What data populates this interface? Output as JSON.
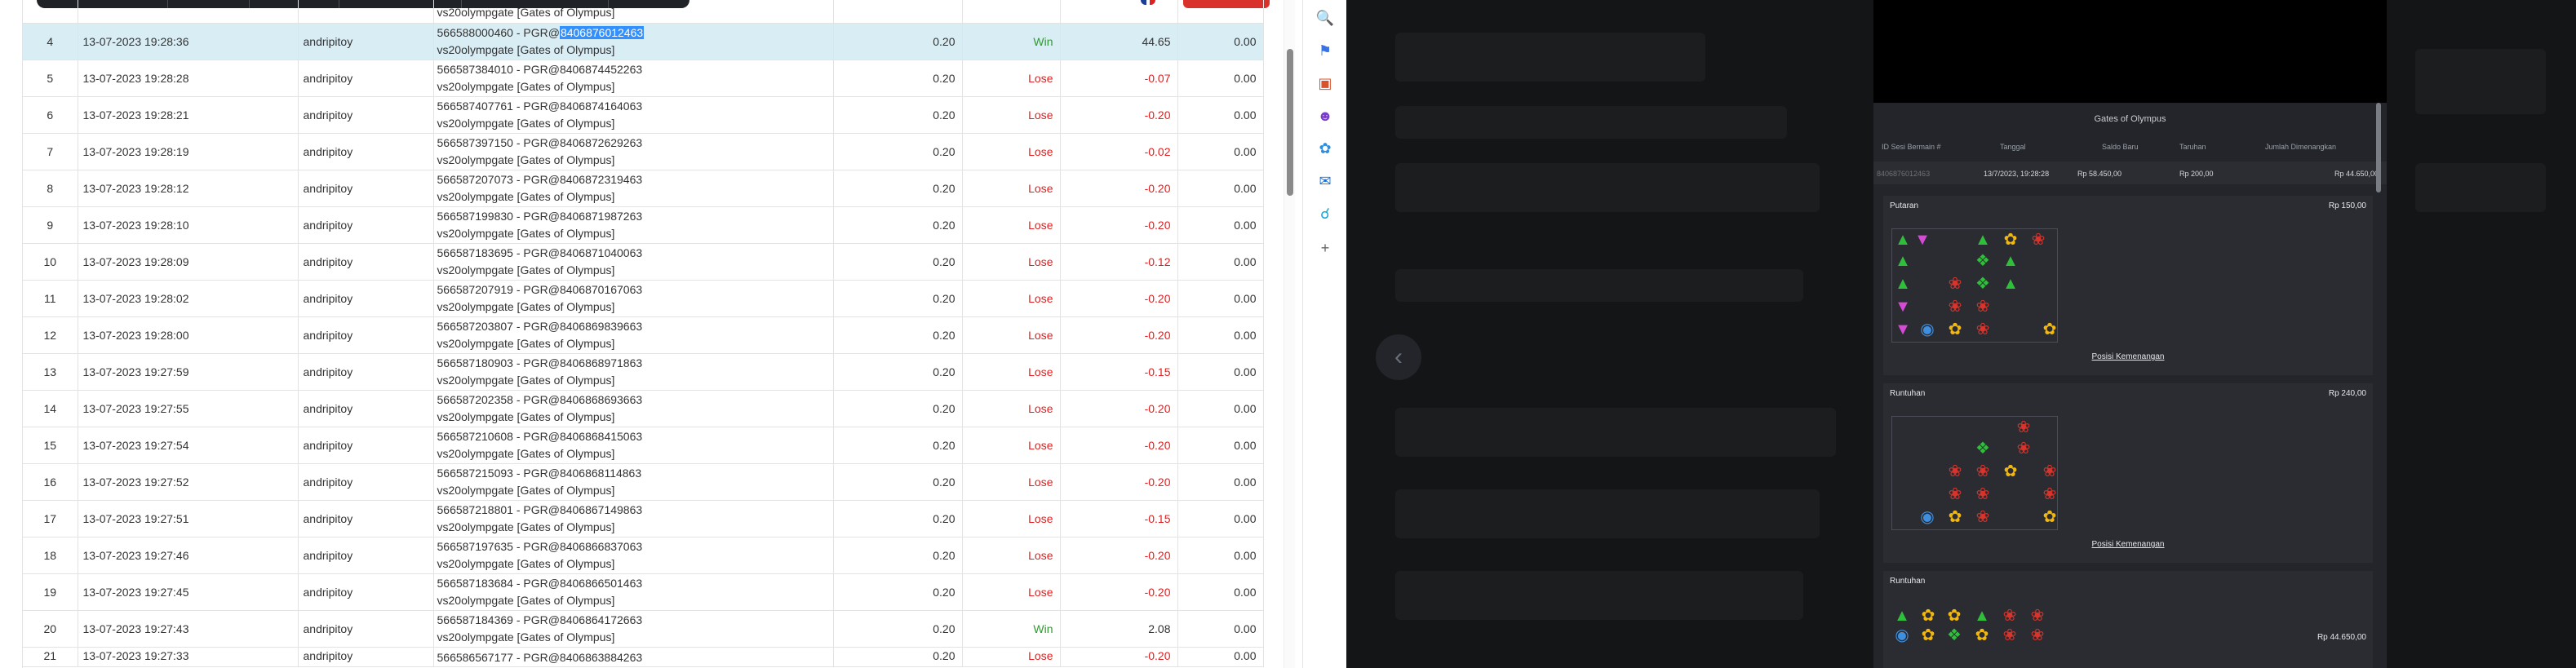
{
  "rows_partial_top": {
    "desc2": "vs20olympgate [Gates of Olympus]"
  },
  "rows": [
    {
      "no": "4",
      "datetime": "13-07-2023 19:28:36",
      "user": "andripitoy",
      "ref_prefix": "566588000460 - PGR@",
      "ref_id": "8406876012463",
      "game": "vs20olympgate [Gates of Olympus]",
      "amount": "0.20",
      "result": "Win",
      "pl": "44.65",
      "bal": "0.00",
      "selected": true
    },
    {
      "no": "5",
      "datetime": "13-07-2023 19:28:28",
      "user": "andripitoy",
      "ref_prefix": "566587384010 - PGR@",
      "ref_id": "8406874452263",
      "game": "vs20olympgate [Gates of Olympus]",
      "amount": "0.20",
      "result": "Lose",
      "pl": "-0.07",
      "bal": "0.00"
    },
    {
      "no": "6",
      "datetime": "13-07-2023 19:28:21",
      "user": "andripitoy",
      "ref_prefix": "566587407761 - PGR@",
      "ref_id": "8406874164063",
      "game": "vs20olympgate [Gates of Olympus]",
      "amount": "0.20",
      "result": "Lose",
      "pl": "-0.20",
      "bal": "0.00"
    },
    {
      "no": "7",
      "datetime": "13-07-2023 19:28:19",
      "user": "andripitoy",
      "ref_prefix": "566587397150 - PGR@",
      "ref_id": "8406872629263",
      "game": "vs20olympgate [Gates of Olympus]",
      "amount": "0.20",
      "result": "Lose",
      "pl": "-0.02",
      "bal": "0.00"
    },
    {
      "no": "8",
      "datetime": "13-07-2023 19:28:12",
      "user": "andripitoy",
      "ref_prefix": "566587207073 - PGR@",
      "ref_id": "8406872319463",
      "game": "vs20olympgate [Gates of Olympus]",
      "amount": "0.20",
      "result": "Lose",
      "pl": "-0.20",
      "bal": "0.00"
    },
    {
      "no": "9",
      "datetime": "13-07-2023 19:28:10",
      "user": "andripitoy",
      "ref_prefix": "566587199830 - PGR@",
      "ref_id": "8406871987263",
      "game": "vs20olympgate [Gates of Olympus]",
      "amount": "0.20",
      "result": "Lose",
      "pl": "-0.20",
      "bal": "0.00"
    },
    {
      "no": "10",
      "datetime": "13-07-2023 19:28:09",
      "user": "andripitoy",
      "ref_prefix": "566587183695 - PGR@",
      "ref_id": "8406871040063",
      "game": "vs20olympgate [Gates of Olympus]",
      "amount": "0.20",
      "result": "Lose",
      "pl": "-0.12",
      "bal": "0.00"
    },
    {
      "no": "11",
      "datetime": "13-07-2023 19:28:02",
      "user": "andripitoy",
      "ref_prefix": "566587207919 - PGR@",
      "ref_id": "8406870167063",
      "game": "vs20olympgate [Gates of Olympus]",
      "amount": "0.20",
      "result": "Lose",
      "pl": "-0.20",
      "bal": "0.00"
    },
    {
      "no": "12",
      "datetime": "13-07-2023 19:28:00",
      "user": "andripitoy",
      "ref_prefix": "566587203807 - PGR@",
      "ref_id": "8406869839663",
      "game": "vs20olympgate [Gates of Olympus]",
      "amount": "0.20",
      "result": "Lose",
      "pl": "-0.20",
      "bal": "0.00"
    },
    {
      "no": "13",
      "datetime": "13-07-2023 19:27:59",
      "user": "andripitoy",
      "ref_prefix": "566587180903 - PGR@",
      "ref_id": "8406868971863",
      "game": "vs20olympgate [Gates of Olympus]",
      "amount": "0.20",
      "result": "Lose",
      "pl": "-0.15",
      "bal": "0.00"
    },
    {
      "no": "14",
      "datetime": "13-07-2023 19:27:55",
      "user": "andripitoy",
      "ref_prefix": "566587202358 - PGR@",
      "ref_id": "8406868693663",
      "game": "vs20olympgate [Gates of Olympus]",
      "amount": "0.20",
      "result": "Lose",
      "pl": "-0.20",
      "bal": "0.00"
    },
    {
      "no": "15",
      "datetime": "13-07-2023 19:27:54",
      "user": "andripitoy",
      "ref_prefix": "566587210608 - PGR@",
      "ref_id": "8406868415063",
      "game": "vs20olympgate [Gates of Olympus]",
      "amount": "0.20",
      "result": "Lose",
      "pl": "-0.20",
      "bal": "0.00"
    },
    {
      "no": "16",
      "datetime": "13-07-2023 19:27:52",
      "user": "andripitoy",
      "ref_prefix": "566587215093 - PGR@",
      "ref_id": "8406868114863",
      "game": "vs20olympgate [Gates of Olympus]",
      "amount": "0.20",
      "result": "Lose",
      "pl": "-0.20",
      "bal": "0.00"
    },
    {
      "no": "17",
      "datetime": "13-07-2023 19:27:51",
      "user": "andripitoy",
      "ref_prefix": "566587218801 - PGR@",
      "ref_id": "8406867149863",
      "game": "vs20olympgate [Gates of Olympus]",
      "amount": "0.20",
      "result": "Lose",
      "pl": "-0.15",
      "bal": "0.00"
    },
    {
      "no": "18",
      "datetime": "13-07-2023 19:27:46",
      "user": "andripitoy",
      "ref_prefix": "566587197635 - PGR@",
      "ref_id": "8406866837063",
      "game": "vs20olympgate [Gates of Olympus]",
      "amount": "0.20",
      "result": "Lose",
      "pl": "-0.20",
      "bal": "0.00"
    },
    {
      "no": "19",
      "datetime": "13-07-2023 19:27:45",
      "user": "andripitoy",
      "ref_prefix": "566587183684 - PGR@",
      "ref_id": "8406866501463",
      "game": "vs20olympgate [Gates of Olympus]",
      "amount": "0.20",
      "result": "Lose",
      "pl": "-0.20",
      "bal": "0.00"
    },
    {
      "no": "20",
      "datetime": "13-07-2023 19:27:43",
      "user": "andripitoy",
      "ref_prefix": "566587184369 - PGR@",
      "ref_id": "8406864172663",
      "game": "vs20olympgate [Gates of Olympus]",
      "amount": "0.20",
      "result": "Win",
      "pl": "2.08",
      "bal": "0.00"
    }
  ],
  "row_partial_bottom": {
    "no": "21",
    "datetime": "13-07-2023 19:27:33",
    "user": "andripitoy",
    "desc": "566586567177 - PGR@8406863884263",
    "amount": "0.20",
    "result": "Lose",
    "pl": "-0.20",
    "bal": "0.00"
  },
  "extensions": [
    "search-icon",
    "tag-icon",
    "toolbox-icon",
    "people-icon",
    "copilot-icon",
    "outlook-icon",
    "cart-icon",
    "plus-icon"
  ],
  "game_panel": {
    "title": "Gates of Olympus",
    "headers": [
      "ID Sesi Bermain #",
      "Tanggal",
      "Saldo Baru",
      "Taruhan",
      "Jumlah Dimenangkan"
    ],
    "values": [
      "8406876012463",
      "13/7/2023, 19:28:28",
      "Rp 58.450,00",
      "Rp 200,00",
      "Rp 44.650,00"
    ],
    "rounds": [
      {
        "title": "Putaran",
        "amount": "Rp 150,00",
        "link": "Posisi Kemenangan"
      },
      {
        "title": "Runtuhan",
        "amount": "Rp 240,00",
        "link": "Posisi Kemenangan"
      },
      {
        "title": "Runtuhan",
        "amount": "Rp 44.650,00",
        "link": ""
      }
    ]
  },
  "colors": {
    "win": "#2e9b2e",
    "lose": "#e02020",
    "selected_row": "#d9edf5",
    "highlight": "#3390ff"
  }
}
